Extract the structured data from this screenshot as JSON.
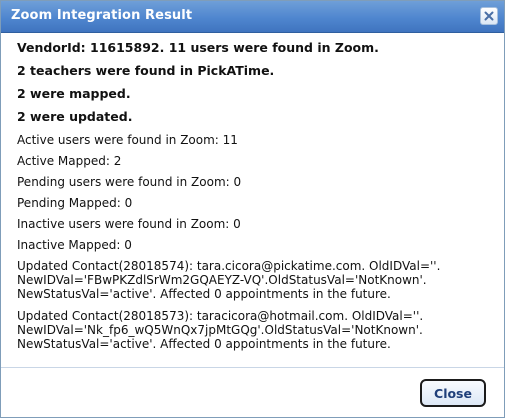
{
  "dialog": {
    "title": "Zoom Integration Result",
    "close_icon": "close-x-icon",
    "accent_color": "#4f86cf",
    "summary": [
      "VendorId: 11615892. 11 users were found in Zoom.",
      "2 teachers were found in PickATime.",
      "2 were mapped.",
      "2 were updated."
    ],
    "details": [
      "Active users were found in Zoom: 11",
      "Active Mapped: 2",
      "Pending users were found in Zoom: 0",
      "Pending Mapped: 0",
      "Inactive users were found in Zoom: 0",
      "Inactive Mapped: 0"
    ],
    "updates": [
      "Updated Contact(28018574): tara.cicora@pickatime.com. OldIDVal=''. NewIDVal='FBwPKZdlSrWm2GQAEYZ-VQ'.OldStatusVal='NotKnown'. NewStatusVal='active'. Affected 0 appointments in the future.",
      "Updated Contact(28018573): taracicora@hotmail.com. OldIDVal=''. NewIDVal='Nk_fp6_wQ5WnQx7jpMtGQg'.OldStatusVal='NotKnown'. NewStatusVal='active'. Affected 0 appointments in the future."
    ],
    "close_button_label": "Close"
  }
}
